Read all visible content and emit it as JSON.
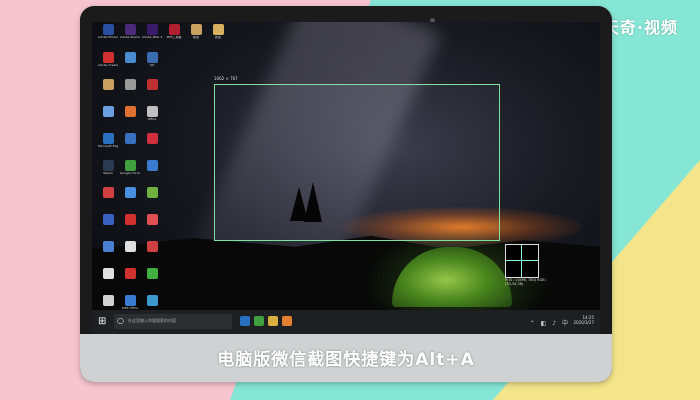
{
  "brand": {
    "text": "天奇·视频"
  },
  "caption": {
    "text": "电脑版微信截图快捷键为Alt+A"
  },
  "screenshot_overlay": {
    "size_label": "1062 × 767",
    "position_label": "POS : (1096, 780)  RGB : (33,34,36)"
  },
  "desktop": {
    "icons": [
      {
        "label": "Adobe Photosh...",
        "color": "#2a4fa0",
        "icon": "photoshop-icon"
      },
      {
        "label": "Adobe Premiere P...",
        "color": "#4a2a7a",
        "icon": "premiere-icon"
      },
      {
        "label": "Adobe After Effects CC",
        "color": "#3a1a6a",
        "icon": "after-effects-icon"
      },
      {
        "label": "PDF工具箱",
        "color": "#b02030",
        "icon": "pdf-icon"
      },
      {
        "label": "新建",
        "color": "#c8a060",
        "icon": "folder-icon"
      },
      {
        "label": "新建",
        "color": "#d8b060",
        "icon": "folder-icon"
      },
      {
        "label": "Adobe Create...",
        "color": "#d03030",
        "icon": "creative-cloud-icon"
      },
      {
        "label": "",
        "color": "#4a8ad0",
        "icon": "app-icon"
      },
      {
        "label": "QQ",
        "color": "#3a6ab0",
        "icon": "qq-icon"
      },
      {
        "label": "",
        "color": "#c8a060",
        "icon": "folder-icon"
      },
      {
        "label": "",
        "color": "#9a9a9a",
        "icon": "file-icon"
      },
      {
        "label": "",
        "color": "#c03030",
        "icon": "app-icon"
      },
      {
        "label": "",
        "color": "#6aa0e0",
        "icon": "app-icon"
      },
      {
        "label": "",
        "color": "#e07030",
        "icon": "app-icon"
      },
      {
        "label": "Office",
        "color": "#c0c0c0",
        "icon": "office-icon"
      },
      {
        "label": "Microsoft Edge",
        "color": "#2a70c0",
        "icon": "edge-icon"
      },
      {
        "label": "",
        "color": "#3a70c0",
        "icon": "app-icon"
      },
      {
        "label": "",
        "color": "#d03040",
        "icon": "app-icon"
      },
      {
        "label": "Steam",
        "color": "#2a3a50",
        "icon": "steam-icon"
      },
      {
        "label": "Google Chrome",
        "color": "#40a040",
        "icon": "chrome-icon"
      },
      {
        "label": "",
        "color": "#3a7ad0",
        "icon": "app-icon"
      },
      {
        "label": "",
        "color": "#d04040",
        "icon": "app-icon"
      },
      {
        "label": "",
        "color": "#4a90e0",
        "icon": "app-icon"
      },
      {
        "label": "",
        "color": "#70b040",
        "icon": "app-icon"
      },
      {
        "label": "",
        "color": "#3a60c0",
        "icon": "app-icon"
      },
      {
        "label": "",
        "color": "#d03030",
        "icon": "app-icon"
      },
      {
        "label": "",
        "color": "#e05050",
        "icon": "app-icon"
      },
      {
        "label": "",
        "color": "#4a80d0",
        "icon": "app-icon"
      },
      {
        "label": "",
        "color": "#e0e0e0",
        "icon": "app-icon"
      },
      {
        "label": "",
        "color": "#d04040",
        "icon": "app-icon"
      },
      {
        "label": "",
        "color": "#e0e0e0",
        "icon": "app-icon"
      },
      {
        "label": "",
        "color": "#d03030",
        "icon": "wps-icon"
      },
      {
        "label": "",
        "color": "#40b040",
        "icon": "wechat-icon"
      },
      {
        "label": "",
        "color": "#d0d0d0",
        "icon": "app-icon"
      },
      {
        "label": "WPS Office",
        "color": "#3a7ad0",
        "icon": "wps-office-icon"
      },
      {
        "label": "",
        "color": "#3a9ad0",
        "icon": "app-icon"
      }
    ]
  },
  "taskbar": {
    "search_placeholder": "在这里输入你要搜索的内容",
    "time": "14:25",
    "date": "2020/3/27",
    "apps": [
      {
        "icon": "edge-icon",
        "color": "#2a70c0"
      },
      {
        "icon": "chrome-icon",
        "color": "#40a040"
      },
      {
        "icon": "explorer-icon",
        "color": "#d8b040"
      },
      {
        "icon": "app-icon",
        "color": "#e08030"
      }
    ]
  }
}
